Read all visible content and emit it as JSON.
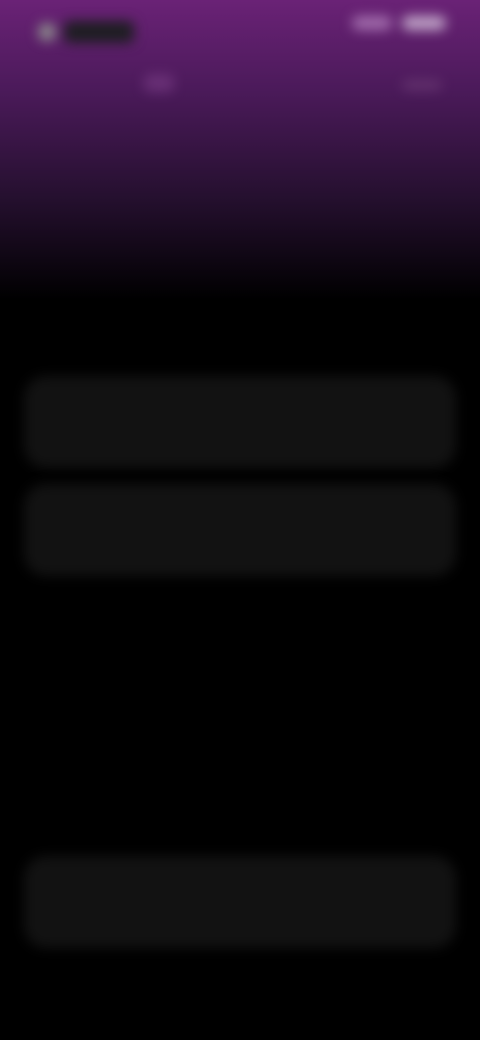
{
  "brand": {
    "logo_icon": "app-logo-icon",
    "accent_color": "#6a2276"
  },
  "header": {
    "top_right_actions": [
      "",
      ""
    ]
  },
  "hero": {
    "headline": "",
    "subtitle": ""
  },
  "actions": {
    "primary_label": "",
    "secondary_label": "",
    "bottom_label": ""
  }
}
